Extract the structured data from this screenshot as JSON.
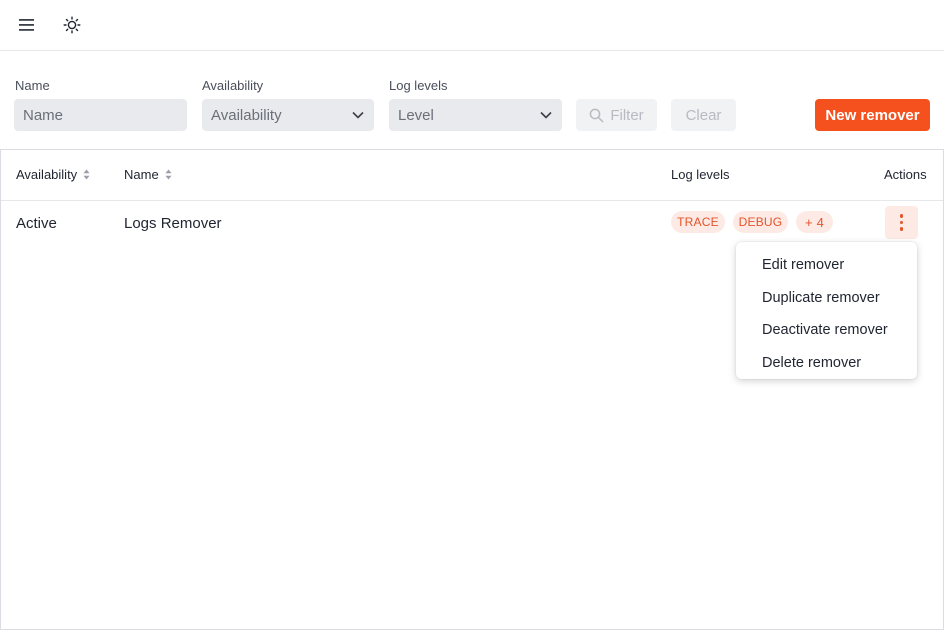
{
  "header": {
    "menu_icon": "hamburger-menu-icon",
    "theme_icon": "sun-icon"
  },
  "filters": {
    "name": {
      "label": "Name",
      "placeholder": "Name"
    },
    "availability": {
      "label": "Availability",
      "value": "Availability"
    },
    "log_levels": {
      "label": "Log levels",
      "value": "Level"
    },
    "filter_label": "Filter",
    "clear_label": "Clear",
    "new_label": "New remover"
  },
  "table": {
    "columns": {
      "availability": "Availability",
      "name": "Name",
      "log_levels": "Log levels",
      "actions": "Actions"
    },
    "rows": [
      {
        "availability": "Active",
        "name": "Logs Remover",
        "levels": [
          "TRACE",
          "DEBUG"
        ],
        "more": "+ 4"
      }
    ]
  },
  "actions_menu": {
    "items": [
      "Edit remover",
      "Duplicate remover",
      "Deactivate remover",
      "Delete remover"
    ]
  },
  "colors": {
    "accent": "#f4511e",
    "tag_bg": "#fdeae4",
    "tag_text": "#e5532b"
  }
}
